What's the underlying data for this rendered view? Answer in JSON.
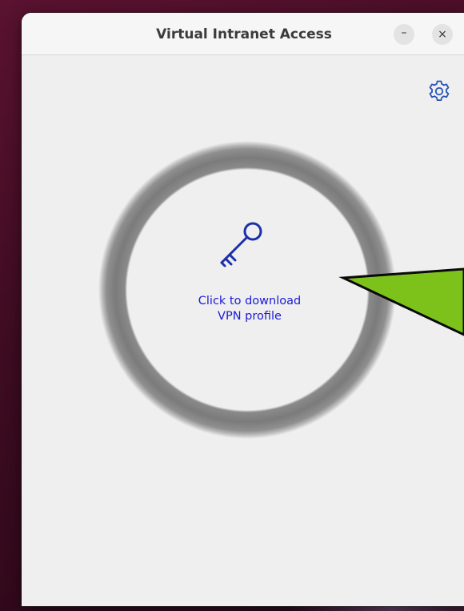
{
  "window": {
    "title": "Virtual Intranet Access",
    "minimize_icon": "minimize-icon",
    "minimize_label": "–",
    "close_icon": "close-icon",
    "close_label": "×",
    "settings_icon": "gear-icon"
  },
  "main": {
    "key_icon": "key-icon",
    "download_line1": "Click to download",
    "download_line2": "VPN profile"
  },
  "colors": {
    "link_blue": "#1b1bd6",
    "ring_gray": "#7b7b7b",
    "callout_green": "#7cc21b",
    "wallpaper": "#4a0f28"
  }
}
